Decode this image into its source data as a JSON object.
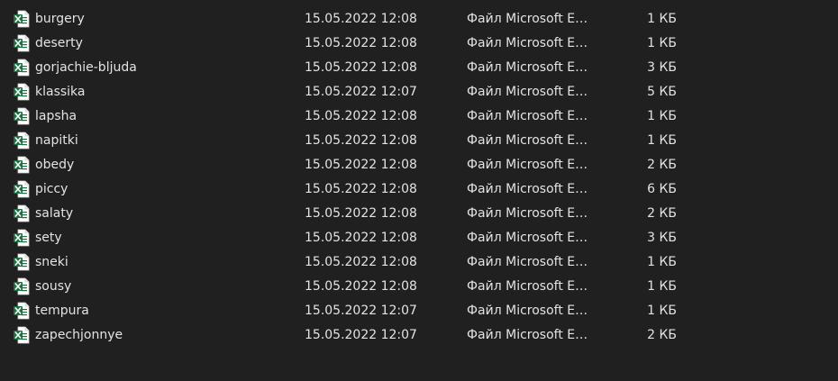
{
  "files": [
    {
      "name": "burgery",
      "modified": "15.05.2022 12:08",
      "type": "Файл Microsoft Ex…",
      "size": "1 КБ",
      "icon": "excel-file-icon"
    },
    {
      "name": "deserty",
      "modified": "15.05.2022 12:08",
      "type": "Файл Microsoft Ex…",
      "size": "1 КБ",
      "icon": "excel-file-icon"
    },
    {
      "name": "gorjachie-bljuda",
      "modified": "15.05.2022 12:08",
      "type": "Файл Microsoft Ex…",
      "size": "3 КБ",
      "icon": "excel-file-icon"
    },
    {
      "name": "klassika",
      "modified": "15.05.2022 12:07",
      "type": "Файл Microsoft Ex…",
      "size": "5 КБ",
      "icon": "excel-file-icon"
    },
    {
      "name": "lapsha",
      "modified": "15.05.2022 12:08",
      "type": "Файл Microsoft Ex…",
      "size": "1 КБ",
      "icon": "excel-file-icon"
    },
    {
      "name": "napitki",
      "modified": "15.05.2022 12:08",
      "type": "Файл Microsoft Ex…",
      "size": "1 КБ",
      "icon": "excel-file-icon"
    },
    {
      "name": "obedy",
      "modified": "15.05.2022 12:08",
      "type": "Файл Microsoft Ex…",
      "size": "2 КБ",
      "icon": "excel-file-icon"
    },
    {
      "name": "piccy",
      "modified": "15.05.2022 12:08",
      "type": "Файл Microsoft Ex…",
      "size": "6 КБ",
      "icon": "excel-file-icon"
    },
    {
      "name": "salaty",
      "modified": "15.05.2022 12:08",
      "type": "Файл Microsoft Ex…",
      "size": "2 КБ",
      "icon": "excel-file-icon"
    },
    {
      "name": "sety",
      "modified": "15.05.2022 12:08",
      "type": "Файл Microsoft Ex…",
      "size": "3 КБ",
      "icon": "excel-file-icon"
    },
    {
      "name": "sneki",
      "modified": "15.05.2022 12:08",
      "type": "Файл Microsoft Ex…",
      "size": "1 КБ",
      "icon": "excel-file-icon"
    },
    {
      "name": "sousy",
      "modified": "15.05.2022 12:08",
      "type": "Файл Microsoft Ex…",
      "size": "1 КБ",
      "icon": "excel-file-icon"
    },
    {
      "name": "tempura",
      "modified": "15.05.2022 12:07",
      "type": "Файл Microsoft Ex…",
      "size": "1 КБ",
      "icon": "excel-file-icon"
    },
    {
      "name": "zapechjonnye",
      "modified": "15.05.2022 12:07",
      "type": "Файл Microsoft Ex…",
      "size": "2 КБ",
      "icon": "excel-file-icon"
    }
  ],
  "colors": {
    "background": "#202020",
    "text": "#e3e3e3",
    "excel_green": "#1d6f42"
  }
}
